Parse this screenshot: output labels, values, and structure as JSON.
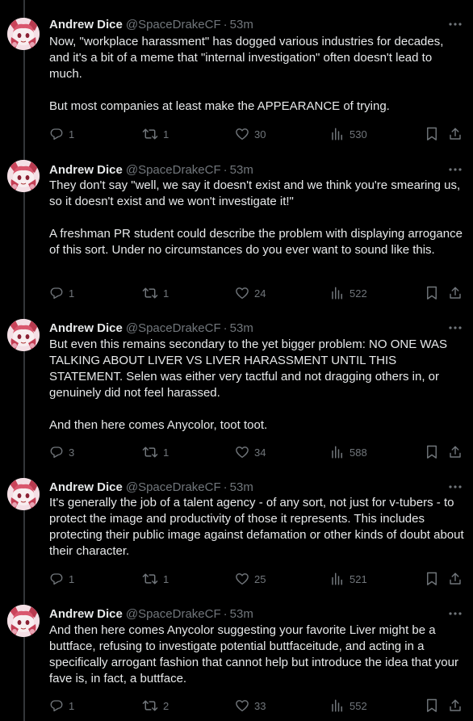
{
  "colors": {
    "background": "#000000",
    "text": "#e7e9ea",
    "muted": "#71767b",
    "thread_line": "#333639"
  },
  "tweets": [
    {
      "name": "Andrew Dice",
      "handle": "@SpaceDrakeCF",
      "dot": "·",
      "time": "53m",
      "paragraphs": [
        "Now, \"workplace harassment\" has dogged various industries for decades, and it's a bit of a meme that \"internal investigation\" often doesn't lead to much.",
        "But most companies at least make the APPEARANCE of trying."
      ],
      "replies": "1",
      "retweets": "1",
      "likes": "30",
      "views": "530"
    },
    {
      "name": "Andrew Dice",
      "handle": "@SpaceDrakeCF",
      "dot": "·",
      "time": "53m",
      "paragraphs": [
        "They don't say \"well, we say it doesn't exist and we think you're smearing us, so it doesn't exist and we won't investigate it!\"",
        "A freshman PR student could describe the problem with displaying arrogance of this sort. Under no circumstances do you ever want to sound like this."
      ],
      "replies": "1",
      "retweets": "1",
      "likes": "24",
      "views": "522"
    },
    {
      "name": "Andrew Dice",
      "handle": "@SpaceDrakeCF",
      "dot": "·",
      "time": "53m",
      "paragraphs": [
        "But even this remains secondary to the yet bigger problem: NO ONE WAS TALKING ABOUT LIVER VS LIVER HARASSMENT UNTIL THIS STATEMENT. Selen was either very tactful and not dragging others in, or genuinely did not feel harassed.",
        "And then here comes Anycolor, toot toot."
      ],
      "replies": "3",
      "retweets": "1",
      "likes": "34",
      "views": "588"
    },
    {
      "name": "Andrew Dice",
      "handle": "@SpaceDrakeCF",
      "dot": "·",
      "time": "53m",
      "paragraphs": [
        "It's generally the job of a talent agency - of any sort, not just for v-tubers - to protect the image and productivity of those it represents. This includes protecting their public image against defamation or other kinds of doubt about their character."
      ],
      "replies": "1",
      "retweets": "1",
      "likes": "25",
      "views": "521"
    },
    {
      "name": "Andrew Dice",
      "handle": "@SpaceDrakeCF",
      "dot": "·",
      "time": "53m",
      "paragraphs": [
        "And then here comes Anycolor suggesting your favorite Liver might be a buttface, refusing to investigate potential buttfaceitude, and acting in a specifically arrogant fashion that cannot help but introduce the idea that your fave is, in fact, a buttface."
      ],
      "replies": "1",
      "retweets": "2",
      "likes": "33",
      "views": "552"
    }
  ],
  "icons": {
    "avatar": "avatar-image",
    "more": "more-icon",
    "reply": "reply-icon",
    "retweet": "retweet-icon",
    "like": "like-icon",
    "views": "views-icon",
    "bookmark": "bookmark-icon",
    "share": "share-icon"
  }
}
